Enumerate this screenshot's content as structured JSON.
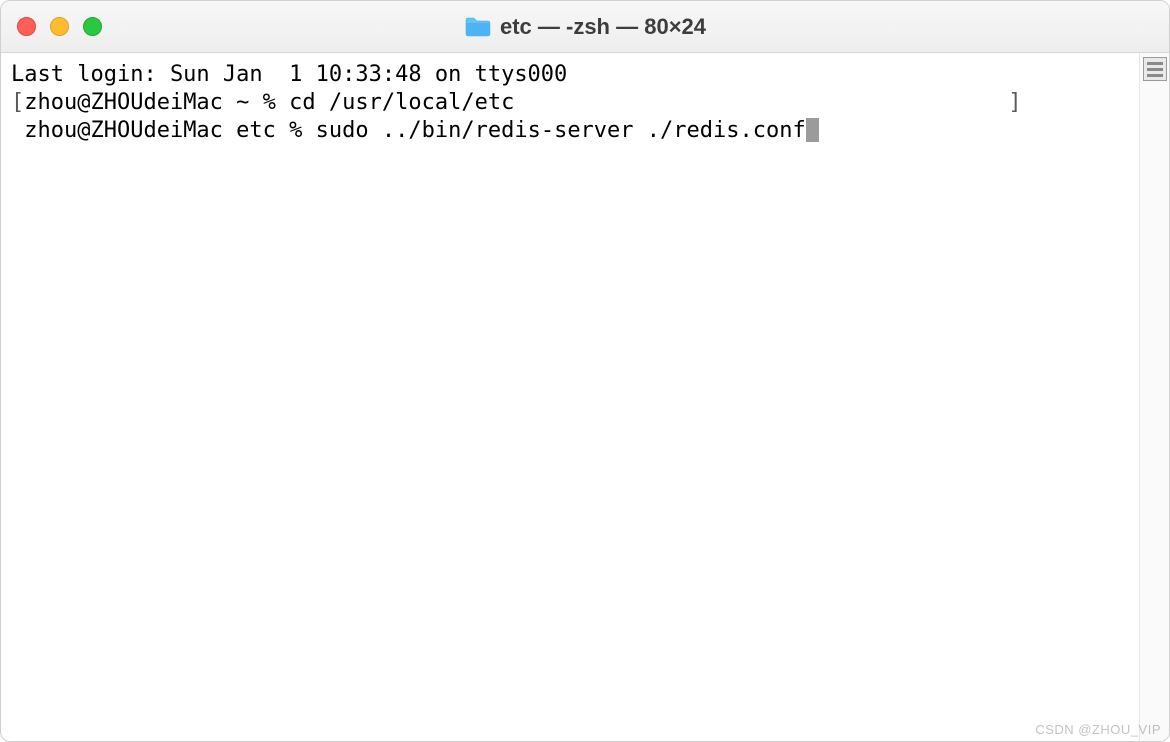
{
  "titlebar": {
    "title": "etc — -zsh — 80×24"
  },
  "terminal": {
    "line1": "Last login: Sun Jan  1 10:33:48 on ttys000",
    "line2_prompt": "zhou@ZHOUdeiMac ~ % ",
    "line2_cmd": "cd /usr/local/etc",
    "line3_prompt": "zhou@ZHOUdeiMac etc % ",
    "line3_cmd": "sudo ../bin/redis-server ./redis.conf",
    "bracket_open": "[",
    "bracket_close": "]"
  },
  "watermark": "CSDN @ZHOU_VIP"
}
